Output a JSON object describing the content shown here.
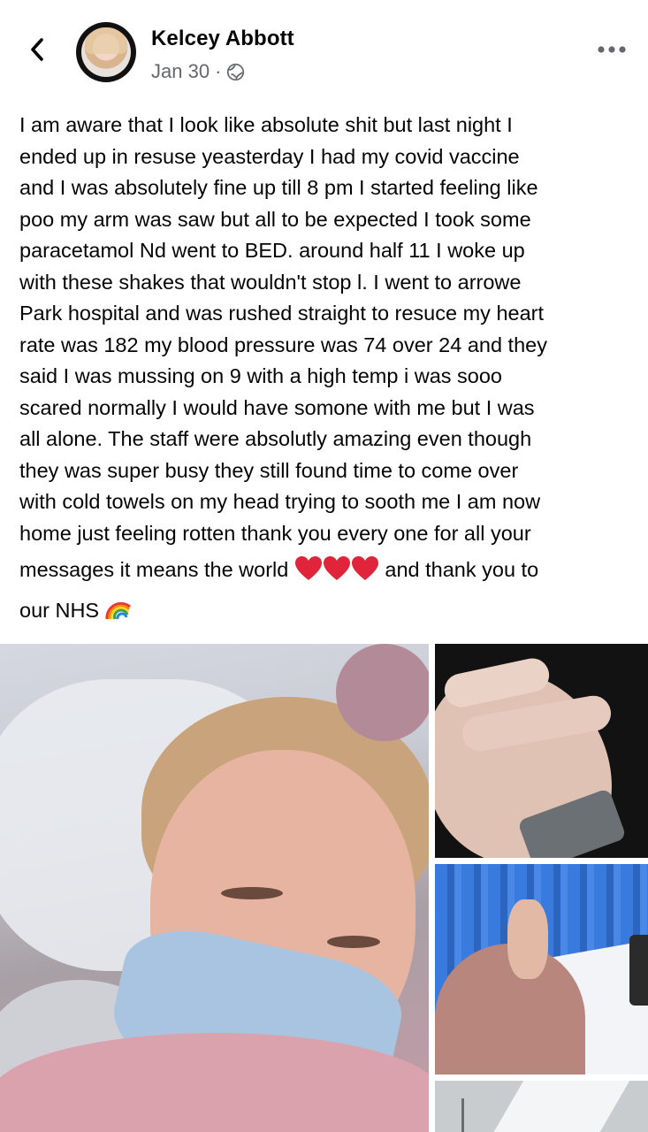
{
  "post": {
    "author": "Kelcey Abbott",
    "date": "Jan 30",
    "separator": "·",
    "privacy_icon": "globe-icon",
    "text_lines": [
      "I am aware that I look like absolute shit but last night I",
      "ended up in resuse yeasterday I had my covid vaccine",
      "and I was absolutely fine up till 8 pm I started feeling like",
      "poo my arm was saw but all to be expected I took some",
      "paracetamol Nd went to BED. around half 11 I woke up",
      "with these shakes that wouldn't stop l. I went to arrowe",
      "Park hospital and was rushed straight to resuce my heart",
      "rate was 182 my blood pressure was 74 over 24 and they",
      "said I was mussing on 9 with a high temp i was sooo",
      "scared normally I would have somone with me but I was",
      "all alone. The staff were absolutly amazing even though",
      "they was super busy they still found time to come over",
      "with cold towels on my head trying to sooth me I am now",
      "home just feeling rotten thank you every one for all your"
    ],
    "line_15_start": "messages it means the world ",
    "line_15_end": " and thank you to",
    "line_16": "our NHS ",
    "emoji": [
      "heart-emoji",
      "heart-emoji",
      "heart-emoji",
      "rainbow-emoji"
    ]
  },
  "header": {
    "back_icon": "chevron-left-icon",
    "more_icon": "more-horizontal-icon"
  },
  "colors": {
    "text": "#050505",
    "secondary": "#65676b",
    "heart": "#e0243a"
  }
}
